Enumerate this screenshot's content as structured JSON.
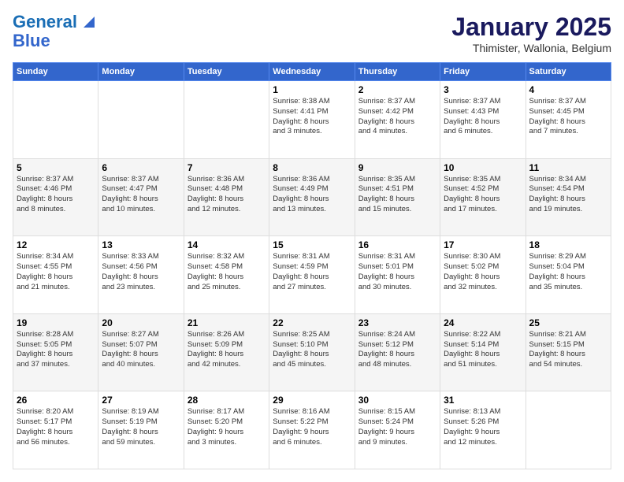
{
  "logo": {
    "line1": "General",
    "line2": "Blue"
  },
  "title": "January 2025",
  "subtitle": "Thimister, Wallonia, Belgium",
  "weekdays": [
    "Sunday",
    "Monday",
    "Tuesday",
    "Wednesday",
    "Thursday",
    "Friday",
    "Saturday"
  ],
  "weeks": [
    [
      {
        "day": "",
        "info": ""
      },
      {
        "day": "",
        "info": ""
      },
      {
        "day": "",
        "info": ""
      },
      {
        "day": "1",
        "info": "Sunrise: 8:38 AM\nSunset: 4:41 PM\nDaylight: 8 hours\nand 3 minutes."
      },
      {
        "day": "2",
        "info": "Sunrise: 8:37 AM\nSunset: 4:42 PM\nDaylight: 8 hours\nand 4 minutes."
      },
      {
        "day": "3",
        "info": "Sunrise: 8:37 AM\nSunset: 4:43 PM\nDaylight: 8 hours\nand 6 minutes."
      },
      {
        "day": "4",
        "info": "Sunrise: 8:37 AM\nSunset: 4:45 PM\nDaylight: 8 hours\nand 7 minutes."
      }
    ],
    [
      {
        "day": "5",
        "info": "Sunrise: 8:37 AM\nSunset: 4:46 PM\nDaylight: 8 hours\nand 8 minutes."
      },
      {
        "day": "6",
        "info": "Sunrise: 8:37 AM\nSunset: 4:47 PM\nDaylight: 8 hours\nand 10 minutes."
      },
      {
        "day": "7",
        "info": "Sunrise: 8:36 AM\nSunset: 4:48 PM\nDaylight: 8 hours\nand 12 minutes."
      },
      {
        "day": "8",
        "info": "Sunrise: 8:36 AM\nSunset: 4:49 PM\nDaylight: 8 hours\nand 13 minutes."
      },
      {
        "day": "9",
        "info": "Sunrise: 8:35 AM\nSunset: 4:51 PM\nDaylight: 8 hours\nand 15 minutes."
      },
      {
        "day": "10",
        "info": "Sunrise: 8:35 AM\nSunset: 4:52 PM\nDaylight: 8 hours\nand 17 minutes."
      },
      {
        "day": "11",
        "info": "Sunrise: 8:34 AM\nSunset: 4:54 PM\nDaylight: 8 hours\nand 19 minutes."
      }
    ],
    [
      {
        "day": "12",
        "info": "Sunrise: 8:34 AM\nSunset: 4:55 PM\nDaylight: 8 hours\nand 21 minutes."
      },
      {
        "day": "13",
        "info": "Sunrise: 8:33 AM\nSunset: 4:56 PM\nDaylight: 8 hours\nand 23 minutes."
      },
      {
        "day": "14",
        "info": "Sunrise: 8:32 AM\nSunset: 4:58 PM\nDaylight: 8 hours\nand 25 minutes."
      },
      {
        "day": "15",
        "info": "Sunrise: 8:31 AM\nSunset: 4:59 PM\nDaylight: 8 hours\nand 27 minutes."
      },
      {
        "day": "16",
        "info": "Sunrise: 8:31 AM\nSunset: 5:01 PM\nDaylight: 8 hours\nand 30 minutes."
      },
      {
        "day": "17",
        "info": "Sunrise: 8:30 AM\nSunset: 5:02 PM\nDaylight: 8 hours\nand 32 minutes."
      },
      {
        "day": "18",
        "info": "Sunrise: 8:29 AM\nSunset: 5:04 PM\nDaylight: 8 hours\nand 35 minutes."
      }
    ],
    [
      {
        "day": "19",
        "info": "Sunrise: 8:28 AM\nSunset: 5:05 PM\nDaylight: 8 hours\nand 37 minutes."
      },
      {
        "day": "20",
        "info": "Sunrise: 8:27 AM\nSunset: 5:07 PM\nDaylight: 8 hours\nand 40 minutes."
      },
      {
        "day": "21",
        "info": "Sunrise: 8:26 AM\nSunset: 5:09 PM\nDaylight: 8 hours\nand 42 minutes."
      },
      {
        "day": "22",
        "info": "Sunrise: 8:25 AM\nSunset: 5:10 PM\nDaylight: 8 hours\nand 45 minutes."
      },
      {
        "day": "23",
        "info": "Sunrise: 8:24 AM\nSunset: 5:12 PM\nDaylight: 8 hours\nand 48 minutes."
      },
      {
        "day": "24",
        "info": "Sunrise: 8:22 AM\nSunset: 5:14 PM\nDaylight: 8 hours\nand 51 minutes."
      },
      {
        "day": "25",
        "info": "Sunrise: 8:21 AM\nSunset: 5:15 PM\nDaylight: 8 hours\nand 54 minutes."
      }
    ],
    [
      {
        "day": "26",
        "info": "Sunrise: 8:20 AM\nSunset: 5:17 PM\nDaylight: 8 hours\nand 56 minutes."
      },
      {
        "day": "27",
        "info": "Sunrise: 8:19 AM\nSunset: 5:19 PM\nDaylight: 8 hours\nand 59 minutes."
      },
      {
        "day": "28",
        "info": "Sunrise: 8:17 AM\nSunset: 5:20 PM\nDaylight: 9 hours\nand 3 minutes."
      },
      {
        "day": "29",
        "info": "Sunrise: 8:16 AM\nSunset: 5:22 PM\nDaylight: 9 hours\nand 6 minutes."
      },
      {
        "day": "30",
        "info": "Sunrise: 8:15 AM\nSunset: 5:24 PM\nDaylight: 9 hours\nand 9 minutes."
      },
      {
        "day": "31",
        "info": "Sunrise: 8:13 AM\nSunset: 5:26 PM\nDaylight: 9 hours\nand 12 minutes."
      },
      {
        "day": "",
        "info": ""
      }
    ]
  ]
}
